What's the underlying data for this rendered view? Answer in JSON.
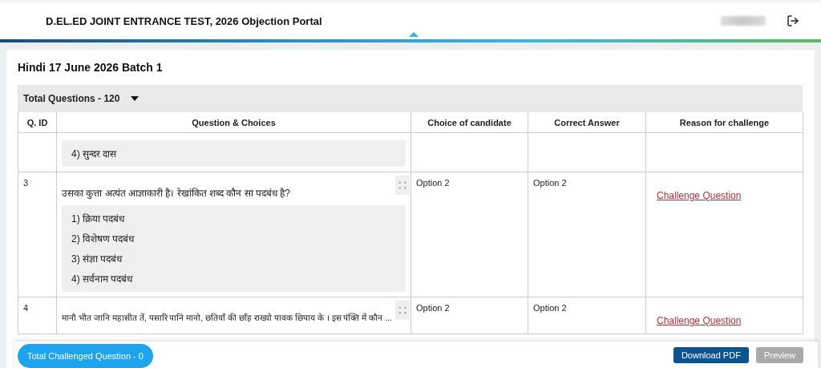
{
  "header": {
    "title": "D.EL.ED JOINT ENTRANCE TEST, 2026 Objection Portal"
  },
  "section": {
    "title": "Hindi 17 June 2026 Batch 1"
  },
  "table": {
    "summary": "Total Questions - 120",
    "columns": [
      "Q. ID",
      "Question & Choices",
      "Choice of candidate",
      "Correct Answer",
      "Reason for challenge"
    ],
    "rows": [
      {
        "kind": "partial",
        "choices": [
          "4) सुन्दर दास"
        ]
      },
      {
        "kind": "full",
        "id": "3",
        "question": "उसका कुत्ता अत्यंत आज्ञाकारी है। रेखांकित शब्द कौन सा पदबंध है?",
        "choices": [
          "1) क्रिया पदबंध",
          "2) विशेषण पदबंध",
          "3) संज्ञा पदबंध",
          "4) सर्वनाम पदबंध"
        ],
        "candidate": "Option 2",
        "correct": "Option 2",
        "action": "Challenge Question"
      },
      {
        "kind": "full",
        "id": "4",
        "question": "मानौ भीत जानि महासीत तें, पसारि पानि मानो, छतियाँ की छाँह राख्यो पावक छिपाय के । इस पंक्ति में कौन ...",
        "candidate": "Option 2",
        "correct": "Option 2",
        "action": "Challenge Question"
      }
    ]
  },
  "footer": {
    "challenged": "Total Challenged Question - 0",
    "buttons": [
      {
        "label": "Download PDF",
        "disabled": false
      },
      {
        "label": "Preview",
        "disabled": true
      }
    ]
  }
}
